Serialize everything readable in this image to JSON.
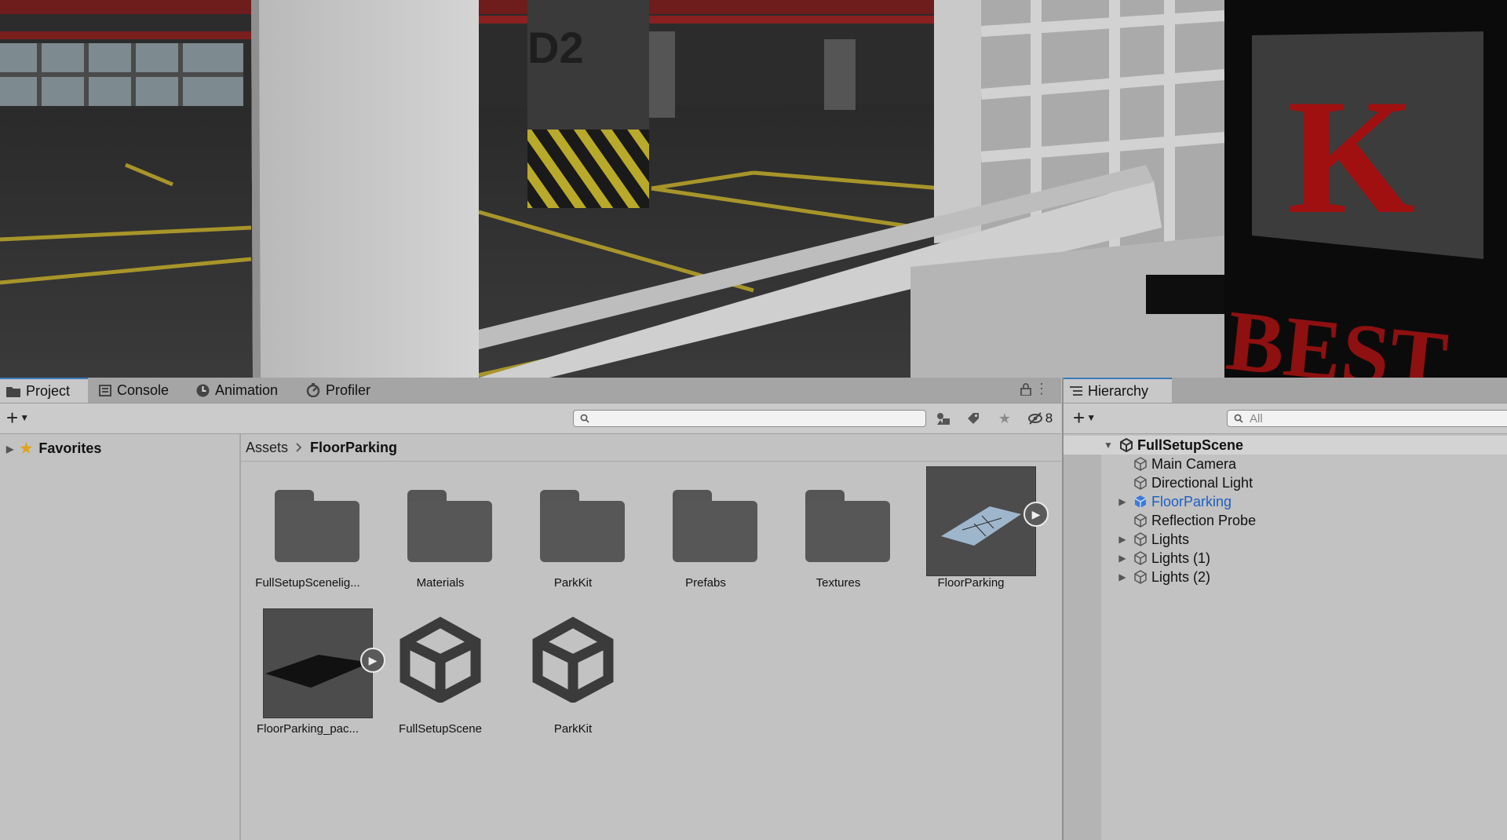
{
  "viewport": {
    "pillar_label": "D2",
    "sign_letter": "K",
    "sign_word": "BEST"
  },
  "project": {
    "tabs": [
      {
        "label": "Project",
        "icon": "folder-icon"
      },
      {
        "label": "Console",
        "icon": "console-icon"
      },
      {
        "label": "Animation",
        "icon": "animation-icon"
      },
      {
        "label": "Profiler",
        "icon": "profiler-icon"
      }
    ],
    "hidden_count": "8",
    "favorites_label": "Favorites",
    "breadcrumb": {
      "root": "Assets",
      "current": "FloorParking"
    },
    "assets": [
      {
        "label": "FullSetupScenelig...",
        "kind": "folder"
      },
      {
        "label": "Materials",
        "kind": "folder"
      },
      {
        "label": "ParkKit",
        "kind": "folder"
      },
      {
        "label": "Prefabs",
        "kind": "folder"
      },
      {
        "label": "Textures",
        "kind": "folder"
      },
      {
        "label": "FloorParking",
        "kind": "model"
      },
      {
        "label": "FloorParking_pac...",
        "kind": "model"
      },
      {
        "label": "FullSetupScene",
        "kind": "unity-scene"
      },
      {
        "label": "ParkKit",
        "kind": "unity-scene"
      }
    ]
  },
  "hierarchy": {
    "tab_label": "Hierarchy",
    "search_placeholder": "All",
    "scene": "FullSetupScene",
    "items": [
      {
        "label": "Main Camera"
      },
      {
        "label": "Directional Light"
      },
      {
        "label": "FloorParking"
      },
      {
        "label": "Reflection Probe"
      },
      {
        "label": "Lights"
      },
      {
        "label": "Lights (1)"
      },
      {
        "label": "Lights (2)"
      }
    ]
  },
  "colors": {
    "accent_tab": "#3a79bb",
    "prefab_blue": "#1f5fbf",
    "panel_bg": "#c2c2c2"
  }
}
